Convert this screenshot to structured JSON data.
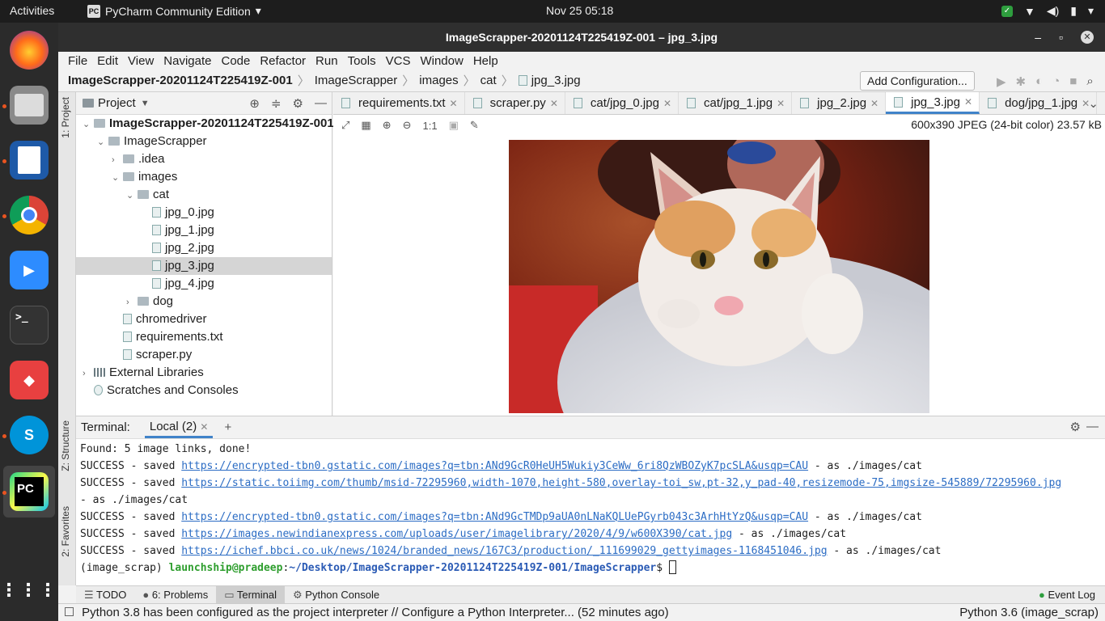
{
  "topbar": {
    "activities": "Activities",
    "app": "PyCharm Community Edition",
    "clock": "Nov 25  05:18"
  },
  "window": {
    "title": "ImageScrapper-20201124T225419Z-001 – jpg_3.jpg"
  },
  "menu": [
    "File",
    "Edit",
    "View",
    "Navigate",
    "Code",
    "Refactor",
    "Run",
    "Tools",
    "VCS",
    "Window",
    "Help"
  ],
  "breadcrumb": [
    "ImageScrapper-20201124T225419Z-001",
    "ImageScrapper",
    "images",
    "cat",
    "jpg_3.jpg"
  ],
  "toolbar": {
    "add_config": "Add Configuration..."
  },
  "side_tabs": {
    "project": "1: Project",
    "structure": "Z: Structure",
    "favorites": "2: Favorites"
  },
  "project": {
    "header": "Project",
    "tree": [
      {
        "label": "ImageScrapper-20201124T225419Z-001",
        "type": "folder",
        "indent": 0,
        "expanded": true,
        "bold": true
      },
      {
        "label": "ImageScrapper",
        "type": "folder",
        "indent": 1,
        "expanded": true
      },
      {
        "label": ".idea",
        "type": "folder",
        "indent": 2,
        "expanded": false
      },
      {
        "label": "images",
        "type": "folder",
        "indent": 2,
        "expanded": true
      },
      {
        "label": "cat",
        "type": "folder",
        "indent": 3,
        "expanded": true
      },
      {
        "label": "jpg_0.jpg",
        "type": "file",
        "indent": 4
      },
      {
        "label": "jpg_1.jpg",
        "type": "file",
        "indent": 4
      },
      {
        "label": "jpg_2.jpg",
        "type": "file",
        "indent": 4
      },
      {
        "label": "jpg_3.jpg",
        "type": "file",
        "indent": 4,
        "selected": true
      },
      {
        "label": "jpg_4.jpg",
        "type": "file",
        "indent": 4
      },
      {
        "label": "dog",
        "type": "folder",
        "indent": 3,
        "expanded": false
      },
      {
        "label": "chromedriver",
        "type": "file",
        "indent": 2
      },
      {
        "label": "requirements.txt",
        "type": "file",
        "indent": 2
      },
      {
        "label": "scraper.py",
        "type": "file",
        "indent": 2
      },
      {
        "label": "External Libraries",
        "type": "lib",
        "indent": 0,
        "expanded": false
      },
      {
        "label": "Scratches and Consoles",
        "type": "scratch",
        "indent": 0
      }
    ]
  },
  "tabs": [
    {
      "label": "requirements.txt"
    },
    {
      "label": "scraper.py"
    },
    {
      "label": "cat/jpg_0.jpg"
    },
    {
      "label": "cat/jpg_1.jpg"
    },
    {
      "label": "jpg_2.jpg"
    },
    {
      "label": "jpg_3.jpg",
      "active": true
    },
    {
      "label": "dog/jpg_1.jpg"
    }
  ],
  "image": {
    "zoom_label": "1:1",
    "info": "600x390 JPEG (24-bit color) 23.57 kB"
  },
  "terminal": {
    "label": "Terminal:",
    "tab": "Local (2)",
    "lines": [
      {
        "text": "Found: 5 image links, done!"
      },
      {
        "prefix": "SUCCESS - saved ",
        "link": "https://encrypted-tbn0.gstatic.com/images?q=tbn:ANd9GcR0HeUH5Wukiy3CeWw_6ri8QzWBOZyK7pcSLA&usqp=CAU",
        "suffix": " - as ./images/cat"
      },
      {
        "prefix": "SUCCESS - saved ",
        "link": "https://static.toiimg.com/thumb/msid-72295960,width-1070,height-580,overlay-toi_sw,pt-32,y_pad-40,resizemode-75,imgsize-545889/72295960.jpg",
        "suffix": ""
      },
      {
        "text": "- as ./images/cat"
      },
      {
        "prefix": "SUCCESS - saved ",
        "link": "https://encrypted-tbn0.gstatic.com/images?q=tbn:ANd9GcTMDp9aUA0nLNaKQLUePGyrb043c3ArhHtYzQ&usqp=CAU",
        "suffix": " - as ./images/cat"
      },
      {
        "prefix": "SUCCESS - saved ",
        "link": "https://images.newindianexpress.com/uploads/user/imagelibrary/2020/4/9/w600X390/cat.jpg",
        "suffix": " - as ./images/cat"
      },
      {
        "prefix": "SUCCESS - saved ",
        "link": "https://ichef.bbci.co.uk/news/1024/branded_news/167C3/production/_111699029_gettyimages-1168451046.jpg",
        "suffix": " - as ./images/cat"
      }
    ],
    "prompt": {
      "env": "(image_scrap) ",
      "user": "launchship@pradeep",
      "colon": ":",
      "path": "~/Desktop/ImageScrapper-20201124T225419Z-001/ImageScrapper",
      "dollar": "$ "
    }
  },
  "toolwindows": [
    {
      "label": "TODO"
    },
    {
      "label": "6: Problems"
    },
    {
      "label": "Terminal",
      "active": true
    },
    {
      "label": "Python Console"
    }
  ],
  "event_log": "Event Log",
  "status": {
    "message": "Python 3.8 has been configured as the project interpreter // Configure a Python Interpreter... (52 minutes ago)",
    "interpreter": "Python 3.6 (image_scrap)"
  }
}
